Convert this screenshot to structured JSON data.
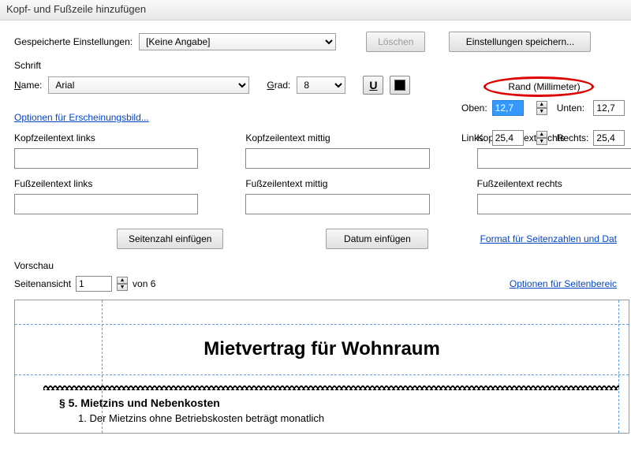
{
  "window": {
    "title": "Kopf- und Fußzeile hinzufügen"
  },
  "saved": {
    "label": "Gespeicherte Einstellungen:",
    "selected": "[Keine Angabe]",
    "delete_label": "Löschen",
    "save_label": "Einstellungen speichern..."
  },
  "font": {
    "group_label": "Schrift",
    "name_label": "Name:",
    "name_value": "Arial",
    "size_label": "Grad:",
    "size_value": "8",
    "underline_icon": "U",
    "appearance_link": "Optionen für Erscheinungsbild..."
  },
  "margin": {
    "group_label": "Rand (Millimeter)",
    "top_label": "Oben:",
    "top_value": "12,7",
    "bottom_label": "Unten:",
    "bottom_value": "12,7",
    "left_label": "Links:",
    "left_value": "25,4",
    "right_label": "Rechts:",
    "right_value": "25,4"
  },
  "hf": {
    "header_left_label": "Kopfzeilentext links",
    "header_center_label": "Kopfzeilentext mittig",
    "header_right_label": "Kopfzeilentext rechts",
    "footer_left_label": "Fußzeilentext links",
    "footer_center_label": "Fußzeilentext mittig",
    "footer_right_label": "Fußzeilentext rechts",
    "header_left_value": "",
    "header_center_value": "",
    "header_right_value": "",
    "footer_left_value": "",
    "footer_center_value": "",
    "footer_right_value": ""
  },
  "insert": {
    "page_number_label": "Seitenzahl einfügen",
    "date_label": "Datum einfügen",
    "format_link": "Format für Seitenzahlen und Dat"
  },
  "preview": {
    "group_label": "Vorschau",
    "page_view_label": "Seitenansicht",
    "page_value": "1",
    "of_label": "von 6",
    "range_link": "Optionen für Seitenbereic"
  },
  "document": {
    "title": "Mietvertrag für Wohnraum",
    "section": "§ 5.   Mietzins und Nebenkosten",
    "item": "1.   Der Mietzins ohne Betriebskosten beträgt monatlich"
  }
}
